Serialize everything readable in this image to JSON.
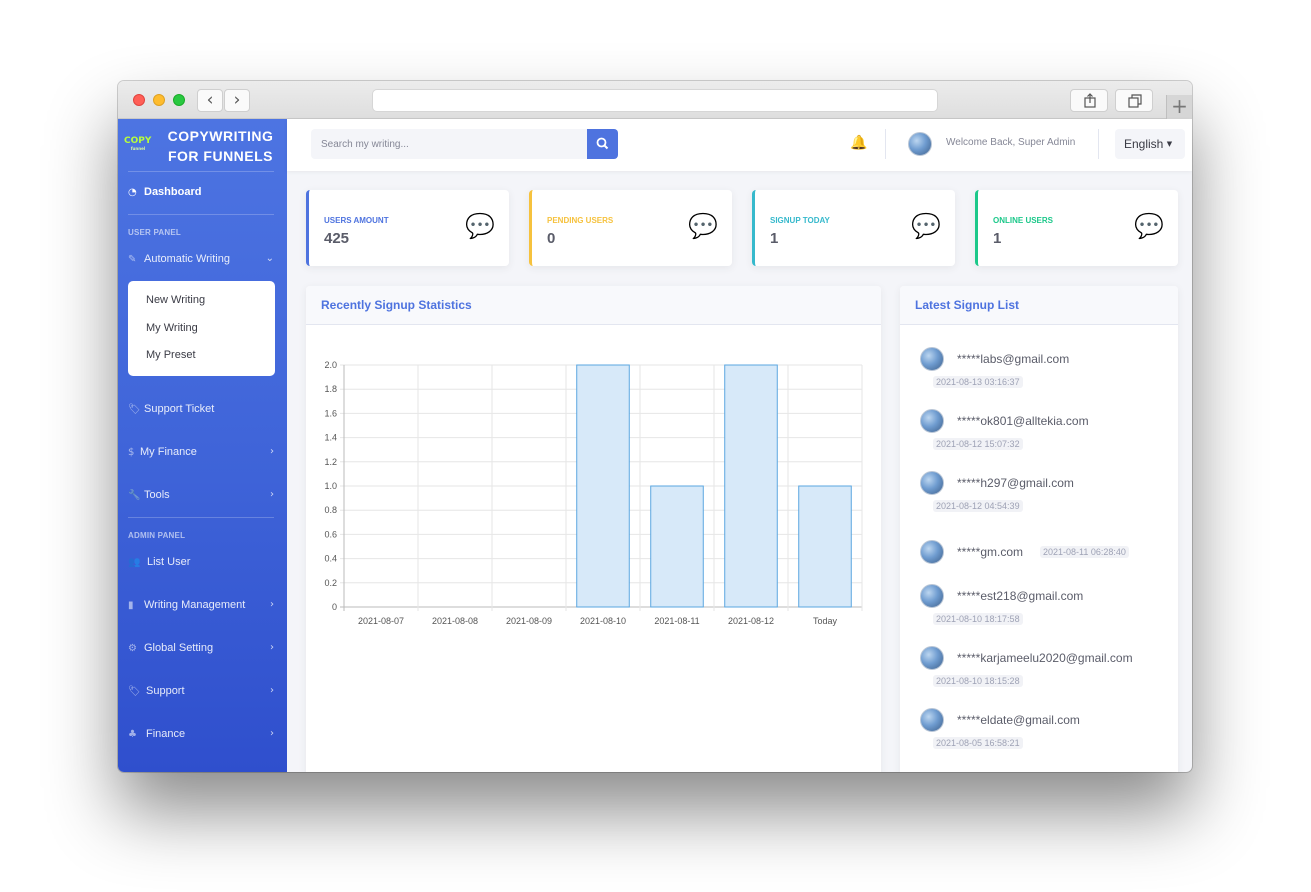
{
  "brand": {
    "logo_text": "COPY",
    "logo_sub": "funnel",
    "title_line1": "COPYWRITING",
    "title_line2": "FOR FUNNELS"
  },
  "sidebar": {
    "dashboard": "Dashboard",
    "user_panel_heading": "USER PANEL",
    "automatic_writing": "Automatic Writing",
    "submenu": [
      "New Writing",
      "My Writing",
      "My Preset"
    ],
    "support_ticket": "Support Ticket",
    "my_finance": "My Finance",
    "tools": "Tools",
    "admin_panel_heading": "ADMIN PANEL",
    "list_user": "List User",
    "writing_management": "Writing Management",
    "global_setting": "Global Setting",
    "support": "Support",
    "finance": "Finance"
  },
  "topbar": {
    "search_placeholder": "Search my writing...",
    "welcome": "Welcome Back, Super Admin",
    "language": "English"
  },
  "stats": [
    {
      "label": "USERS AMOUNT",
      "value": "425",
      "color": "#4e73df"
    },
    {
      "label": "PENDING USERS",
      "value": "0",
      "color": "#f6c23e"
    },
    {
      "label": "SIGNUP TODAY",
      "value": "1",
      "color": "#36b9cc"
    },
    {
      "label": "ONLINE USERS",
      "value": "1",
      "color": "#1cc88a"
    }
  ],
  "panels": {
    "stats_title": "Recently Signup Statistics",
    "list_title": "Latest Signup List"
  },
  "chart_data": {
    "type": "bar",
    "categories": [
      "2021-08-07",
      "2021-08-08",
      "2021-08-09",
      "2021-08-10",
      "2021-08-11",
      "2021-08-12",
      "Today"
    ],
    "values": [
      0,
      0,
      0,
      2,
      1,
      2,
      1
    ],
    "ylim": [
      0,
      2.0
    ],
    "yticks": [
      "0",
      "0.2",
      "0.4",
      "0.6",
      "0.8",
      "1.0",
      "1.2",
      "1.4",
      "1.6",
      "1.8",
      "2.0"
    ],
    "title": "",
    "xlabel": "",
    "ylabel": "",
    "grid": true,
    "bar_fill": "#d7e9f9",
    "bar_stroke": "#5aa6e0"
  },
  "signups": [
    {
      "email": "*****labs@gmail.com",
      "time": "2021-08-13 03:16:37"
    },
    {
      "email": "*****ok801@alltekia.com",
      "time": "2021-08-12 15:07:32"
    },
    {
      "email": "*****h297@gmail.com",
      "time": "2021-08-12 04:54:39"
    },
    {
      "email": "*****gm.com",
      "time": "2021-08-11 06:28:40"
    },
    {
      "email": "*****est218@gmail.com",
      "time": "2021-08-10 18:17:58"
    },
    {
      "email": "*****karjameelu2020@gmail.com",
      "time": "2021-08-10 18:15:28"
    },
    {
      "email": "*****eldate@gmail.com",
      "time": "2021-08-05 16:58:21"
    }
  ]
}
